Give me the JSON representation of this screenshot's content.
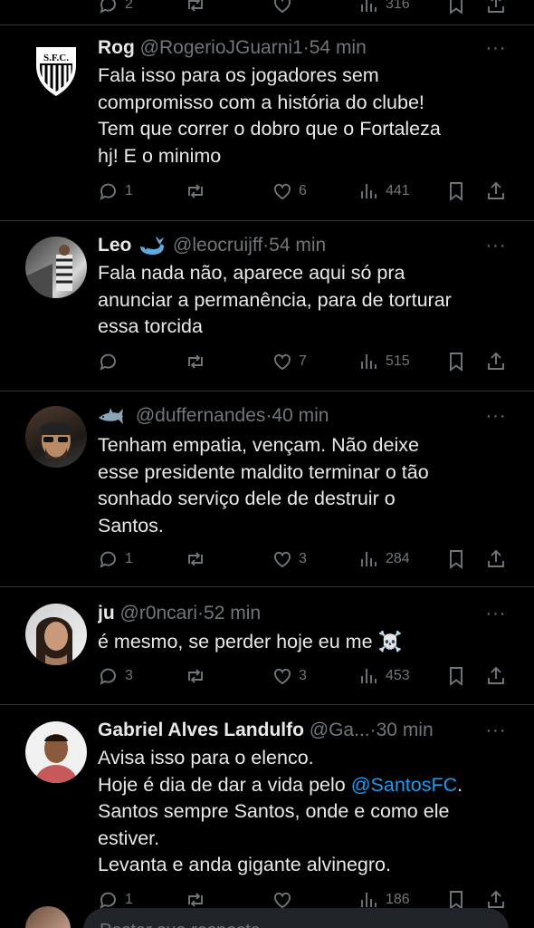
{
  "top_partial": {
    "replies": "2",
    "views": "316"
  },
  "tweets": [
    {
      "name": "Rog",
      "handle": "@RogerioJGuarni1",
      "dot": "·",
      "time": "54 min",
      "text": "Fala isso para os jogadores sem\ncompromisso com a história do clube!\nTem que correr o dobro que o Fortaleza\nhj! E o minimo",
      "replies": "1",
      "reposts": "",
      "likes": "6",
      "views": "441"
    },
    {
      "name": "Leo",
      "handle": "@leocruijff",
      "dot": "·",
      "time": "54 min",
      "text": "Fala nada não, aparece aqui só pra\nanunciar a permanência, para de torturar\nessa torcida",
      "replies": "",
      "reposts": "",
      "likes": "7",
      "views": "515"
    },
    {
      "name": "",
      "handle": "@duffernandes",
      "dot": "·",
      "time": "40 min",
      "text": "Tenham empatia, vençam. Não deixe\nesse presidente maldito terminar o tão\nsonhado serviço dele de destruir o\nSantos.",
      "replies": "1",
      "reposts": "",
      "likes": "3",
      "views": "284"
    },
    {
      "name": "ju",
      "handle": "@r0ncari",
      "dot": "·",
      "time": "52 min",
      "text": "é mesmo, se perder hoje eu me ☠️",
      "replies": "3",
      "reposts": "",
      "likes": "3",
      "views": "453"
    },
    {
      "name": "Gabriel Alves Landulfo",
      "handle": "@Ga...",
      "dot": "·",
      "time": "30 min",
      "text_before": "Avisa isso para o elenco.\nHoje é dia de dar a vida pelo ",
      "mention": "@SantosFC",
      "text_after": ".\nSantos sempre Santos, onde e como ele\nestiver.\nLevanta e anda gigante alvinegro.",
      "replies": "1",
      "reposts": "",
      "likes": "",
      "views": "186"
    }
  ],
  "composer": {
    "placeholder": "Postar sua resposta"
  },
  "colors": {
    "background": "#000000",
    "text": "#e7e9ea",
    "muted": "#71767b",
    "link": "#1d9bf0",
    "divider": "#2f3336"
  },
  "icons": [
    "reply-icon",
    "repost-icon",
    "like-icon",
    "views-icon",
    "bookmark-icon",
    "share-icon",
    "more-icon",
    "whale-emoji",
    "shark-emoji",
    "skull-emoji"
  ]
}
